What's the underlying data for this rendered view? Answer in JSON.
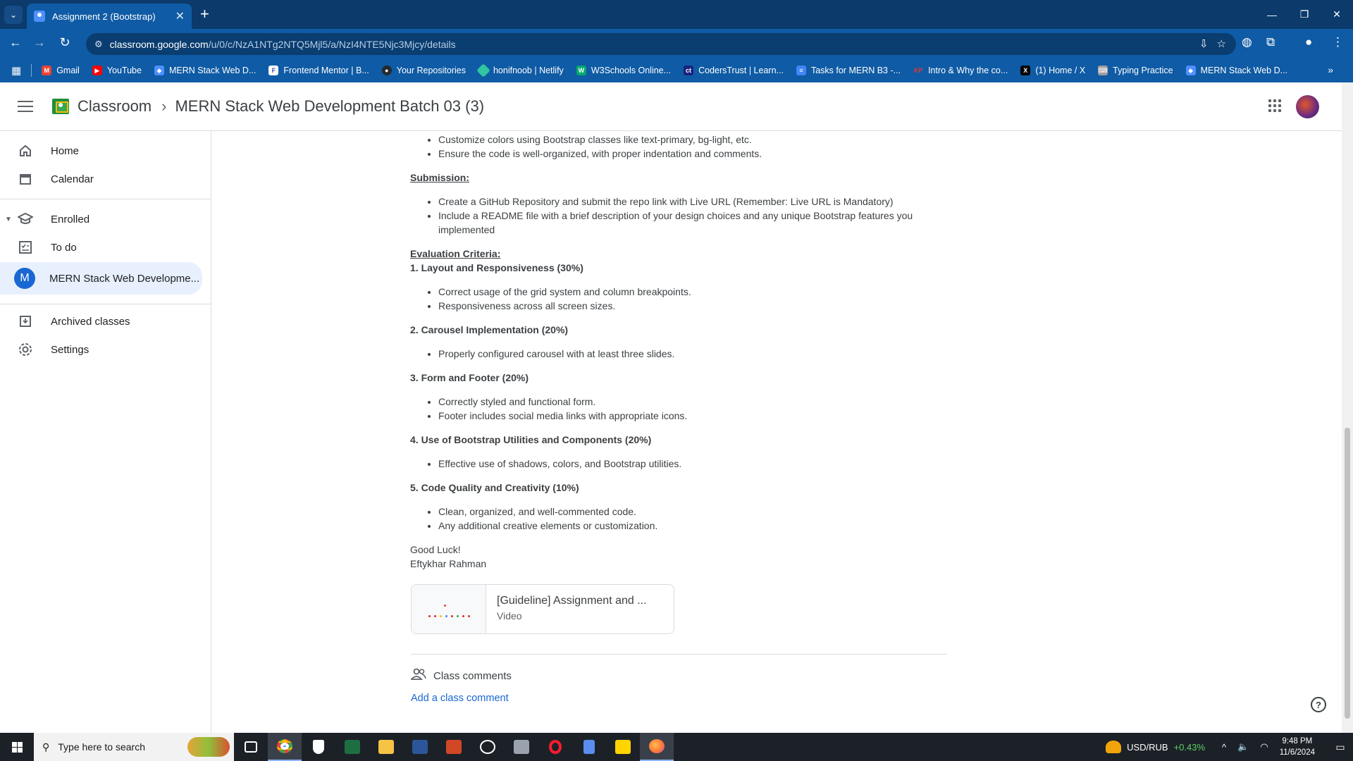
{
  "browser": {
    "tab_title": "Assignment 2 (Bootstrap)",
    "url_host": "classroom.google.com",
    "url_path": "/u/0/c/NzA1NTg2NTQ5Mjl5/a/NzI4NTE5Njc3Mjcy/details",
    "bookmarks": [
      {
        "label": "Gmail",
        "color": "#ea4335"
      },
      {
        "label": "YouTube",
        "color": "#ff0000"
      },
      {
        "label": "MERN Stack Web D...",
        "color": "#4d90fe"
      },
      {
        "label": "Frontend Mentor | B...",
        "color": "#ffffff"
      },
      {
        "label": "Your Repositories",
        "color": "#24292e"
      },
      {
        "label": "honifnoob | Netlify",
        "color": "#32c5a0"
      },
      {
        "label": "W3Schools Online...",
        "color": "#04aa6d"
      },
      {
        "label": "CodersTrust | Learn...",
        "color": "#1a237e"
      },
      {
        "label": "Tasks for MERN B3 -...",
        "color": "#4285f4"
      },
      {
        "label": "Intro & Why the co...",
        "color": "#e53935"
      },
      {
        "label": "(1) Home / X",
        "color": "#000000"
      },
      {
        "label": "Typing Practice",
        "color": "#9e9e9e"
      },
      {
        "label": "MERN Stack Web D...",
        "color": "#4d90fe"
      }
    ]
  },
  "header": {
    "app_name": "Classroom",
    "class_title": "MERN Stack Web Development Batch 03 (3)"
  },
  "sidebar": {
    "home": "Home",
    "calendar": "Calendar",
    "enrolled": "Enrolled",
    "todo": "To do",
    "class_initial": "M",
    "class_name": "MERN Stack Web Developme...",
    "archived": "Archived classes",
    "settings": "Settings"
  },
  "assignment": {
    "intro_bullets": [
      "Customize colors using Bootstrap classes like text-primary, bg-light, etc.",
      "Ensure the code is well-organized, with proper indentation and comments."
    ],
    "submission_label": "Submission:",
    "submission_bullets": [
      "Create a GitHub Repository and submit the repo link with Live URL (Remember: Live URL is Mandatory)",
      "Include a README file with a brief description of your design choices and any unique Bootstrap features you implemented"
    ],
    "evaluation_label": "Evaluation Criteria:",
    "criteria": [
      {
        "title": "1. Layout and Responsiveness (30%)",
        "bullets": [
          "Correct usage of the grid system and column breakpoints.",
          "Responsiveness across all screen sizes."
        ]
      },
      {
        "title": "2. Carousel Implementation (20%)",
        "bullets": [
          "Properly configured carousel with at least three slides."
        ]
      },
      {
        "title": "3. Form and Footer (20%)",
        "bullets": [
          "Correctly styled and functional form.",
          "Footer includes social media links with appropriate icons."
        ]
      },
      {
        "title": "4. Use of Bootstrap Utilities and Components (20%)",
        "bullets": [
          "Effective use of shadows, colors, and Bootstrap utilities."
        ]
      },
      {
        "title": "5. Code Quality and Creativity (10%)",
        "bullets": [
          "Clean, organized, and well-commented code.",
          "Any additional creative elements or customization."
        ]
      }
    ],
    "closing": "Good Luck!",
    "author": "Eftykhar Rahman",
    "attachment_title": "[Guideline] Assignment and ...",
    "attachment_type": "Video"
  },
  "comments": {
    "heading": "Class comments",
    "add_link": "Add a class comment"
  },
  "taskbar": {
    "search_placeholder": "Type here to search",
    "fx_pair": "USD/RUB",
    "fx_change": "+0.43%",
    "time": "9:48 PM",
    "date": "11/6/2024"
  }
}
